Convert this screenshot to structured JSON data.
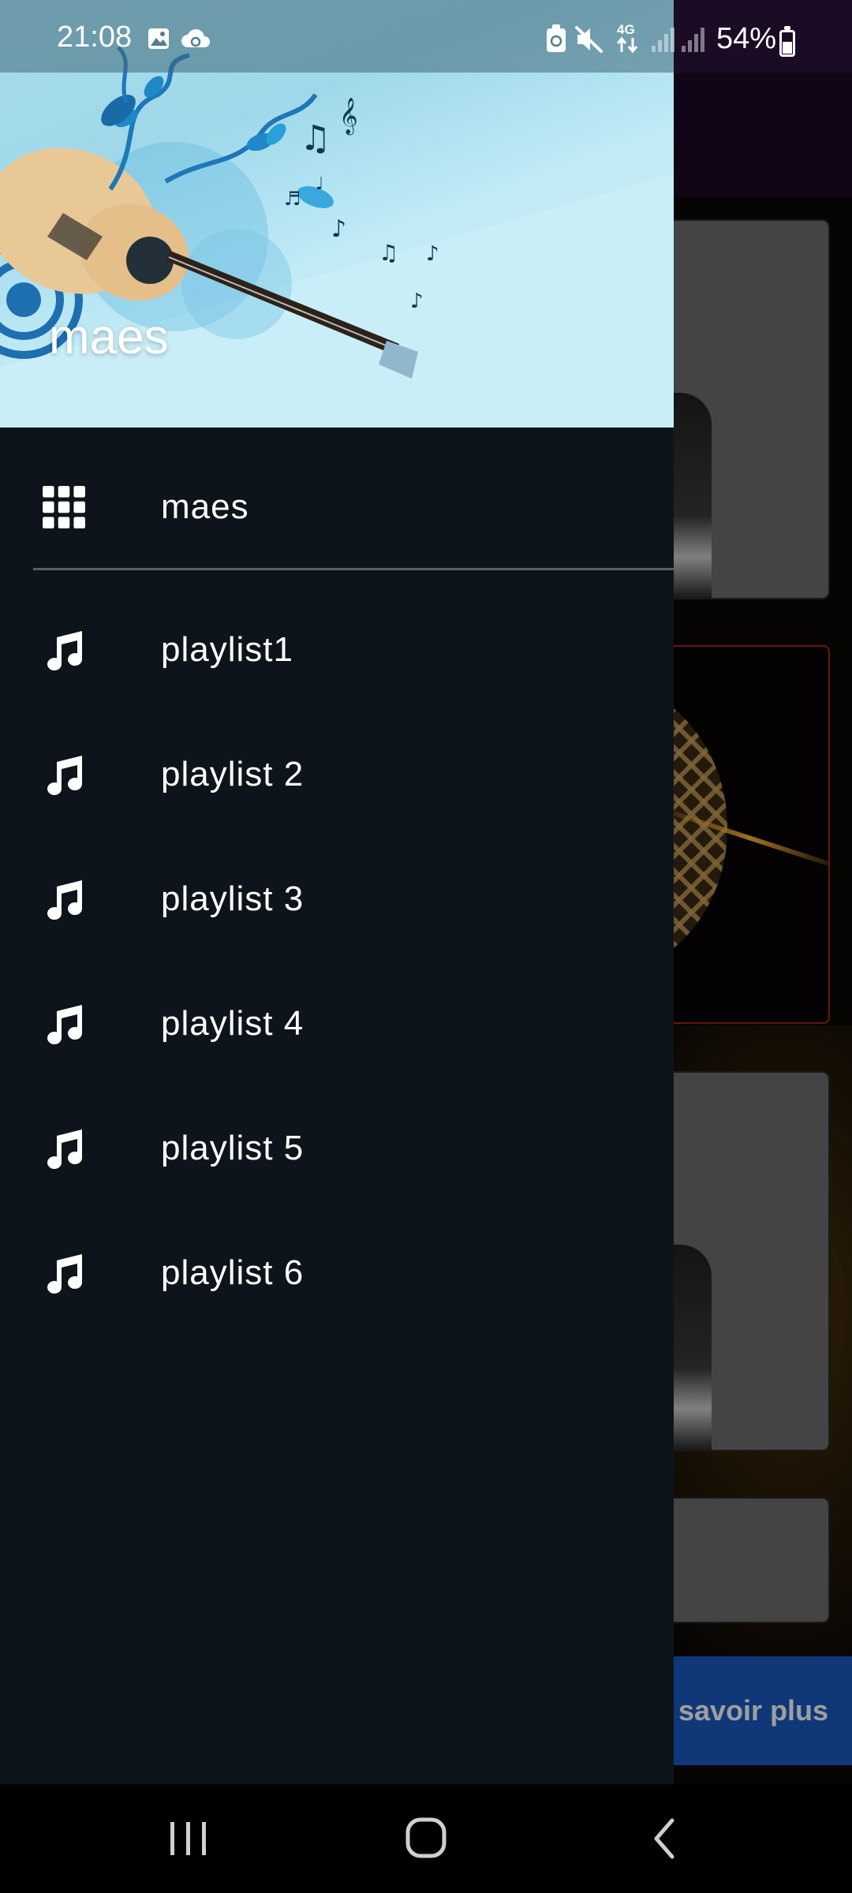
{
  "status_bar": {
    "time": "21:08",
    "battery_percent": "54%",
    "battery_level": 0.54,
    "network_label": "4G",
    "icons": [
      "gallery-icon",
      "cloud-sync-icon",
      "battery-saver-icon",
      "mute-icon",
      "mobile-data-icon",
      "signal-icon",
      "signal-icon",
      "battery-icon"
    ]
  },
  "drawer": {
    "header_title": "maes",
    "menu": [
      {
        "label": "maes",
        "icon": "grid-icon"
      }
    ],
    "playlists": [
      {
        "label": "playlist1",
        "icon": "music-note-icon"
      },
      {
        "label": "playlist 2",
        "icon": "music-note-icon"
      },
      {
        "label": "playlist 3",
        "icon": "music-note-icon"
      },
      {
        "label": "playlist 4",
        "icon": "music-note-icon"
      },
      {
        "label": "playlist 5",
        "icon": "music-note-icon"
      },
      {
        "label": "playlist 6",
        "icon": "music-note-icon"
      }
    ]
  },
  "background_app": {
    "more_button_label": "savoir plus"
  },
  "nav_bar": {
    "buttons": [
      "recent-apps-icon",
      "home-icon",
      "back-icon"
    ]
  },
  "colors": {
    "drawer_bg": "#0e141c",
    "header_bg": "#a8dcec",
    "app_bar": "#1c0b24",
    "button_blue": "#1a5bc2",
    "text": "#ffffff"
  }
}
